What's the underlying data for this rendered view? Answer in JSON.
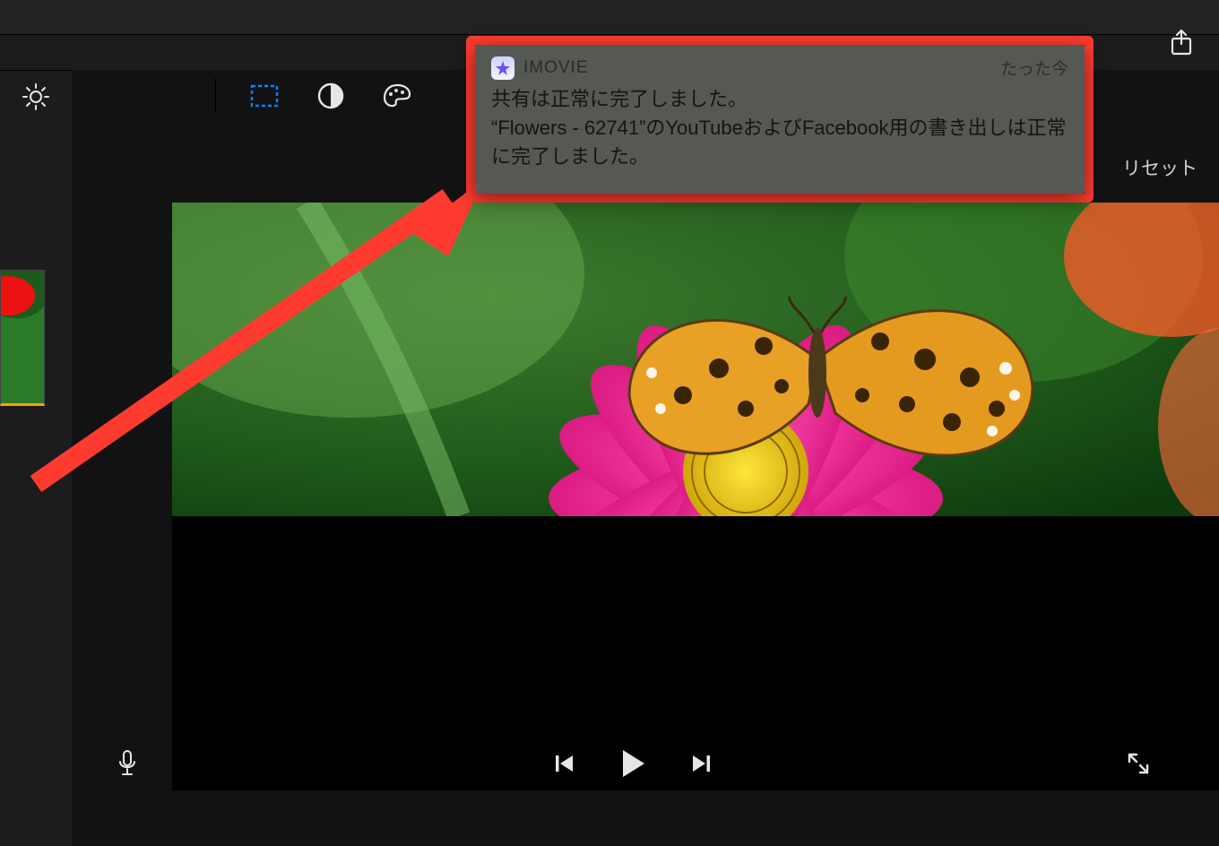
{
  "notification": {
    "app_name": "IMOVIE",
    "time": "たった今",
    "title": "共有は正常に完了しました。",
    "body": "“Flowers - 62741”のYouTubeおよびFacebook用の書き出しは正常に完了しました。"
  },
  "toolbar": {
    "reset_label": "リセット"
  },
  "colors": {
    "annotation": "#ff3b2f",
    "active_tool": "#0a84ff",
    "thumb_indicator": "#ff9f0a"
  }
}
